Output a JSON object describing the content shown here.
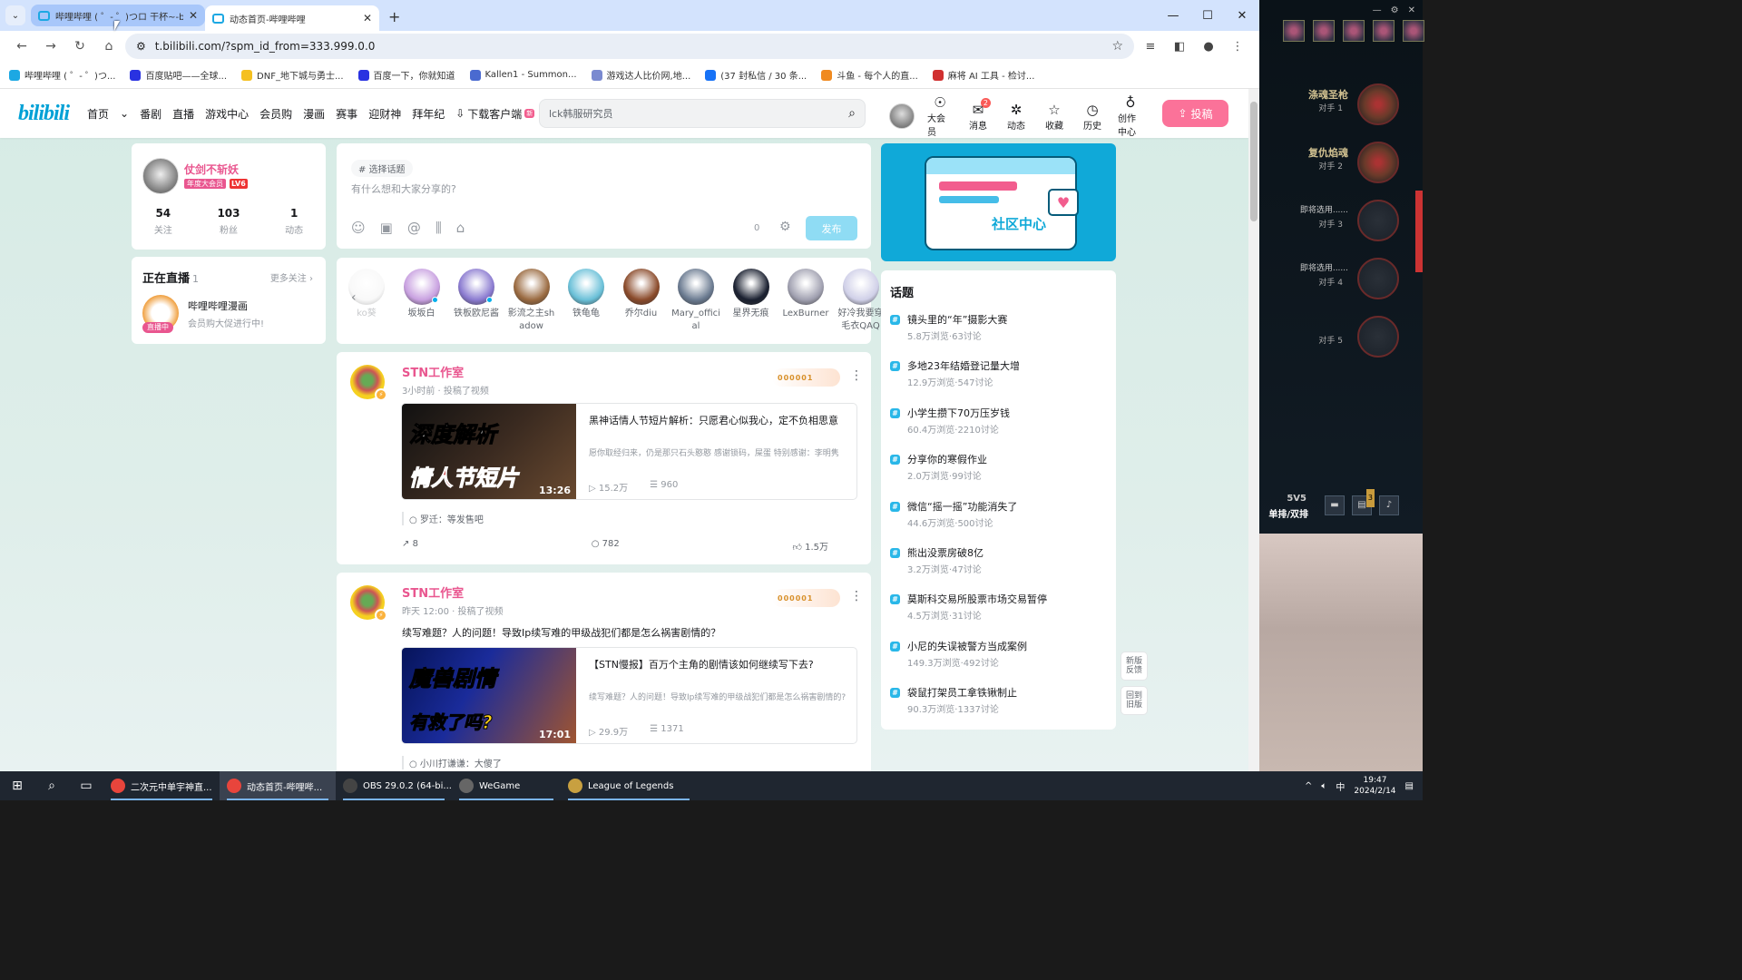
{
  "browser": {
    "tabs": [
      {
        "label": "哔哩哔哩 ( ゜- ゜)つロ 干杯~-bi",
        "active": false
      },
      {
        "label": "动态首页-哔哩哔哩",
        "active": true
      }
    ],
    "url": "t.bilibili.com/?spm_id_from=333.999.0.0",
    "bookmarks": [
      {
        "label": "哔哩哔哩 ( ゜- ゜)つ...",
        "color": "#1ca8e3"
      },
      {
        "label": "百度贴吧——全球...",
        "color": "#2932e1"
      },
      {
        "label": "DNF_地下城与勇士...",
        "color": "#f5c020"
      },
      {
        "label": "百度一下，你就知道",
        "color": "#2932e1"
      },
      {
        "label": "Kallen1 - Summon...",
        "color": "#4a6ad0"
      },
      {
        "label": "游戏达人比价网,地...",
        "color": "#7a8ad0"
      },
      {
        "label": "(37 封私信 / 30 条...",
        "color": "#1772f6"
      },
      {
        "label": "斗鱼 - 每个人的直...",
        "color": "#f08a20"
      },
      {
        "label": "麻将 AI 工具 - 检讨...",
        "color": "#d03030"
      }
    ]
  },
  "header": {
    "logo": "bilibili",
    "nav": [
      "首页",
      "番剧",
      "直播",
      "游戏中心",
      "会员购",
      "漫画",
      "赛事",
      "迎财神",
      "拜年纪"
    ],
    "download": "下载客户端",
    "download_badge": "新",
    "search_placeholder": "lck韩服研究员",
    "icons": [
      {
        "label": "大会员",
        "glyph": "☉"
      },
      {
        "label": "消息",
        "glyph": "✉",
        "badge": "2"
      },
      {
        "label": "动态",
        "glyph": "✲"
      },
      {
        "label": "收藏",
        "glyph": "☆"
      },
      {
        "label": "历史",
        "glyph": "◷"
      },
      {
        "label": "创作中心",
        "glyph": "♁"
      }
    ],
    "upload": "投稿"
  },
  "user": {
    "name": "仗剑不斩妖",
    "vip": "年度大会员",
    "level": "LV6",
    "stats": [
      {
        "value": "54",
        "label": "关注"
      },
      {
        "value": "103",
        "label": "粉丝"
      },
      {
        "value": "1",
        "label": "动态"
      }
    ]
  },
  "live": {
    "title": "正在直播",
    "count": "1",
    "more": "更多关注 ›",
    "tag": "直播中",
    "name": "哔哩哔哩漫画",
    "desc": "会员购大促进行中!"
  },
  "compose": {
    "topic": "选择话题",
    "placeholder": "有什么想和大家分享的?",
    "count": "0",
    "publish": "发布"
  },
  "ups": [
    {
      "name": "ko葵",
      "color": "#eee",
      "live": false
    },
    {
      "name": "坂坂白",
      "color": "#c8a0e0",
      "live": true
    },
    {
      "name": "铁板欧尼酱",
      "color": "#8a7ad0",
      "live": true
    },
    {
      "name": "影流之主shadow",
      "color": "#9a6a40",
      "live": false
    },
    {
      "name": "铁龟龟",
      "color": "#6ac0d8",
      "live": false
    },
    {
      "name": "乔尔diu",
      "color": "#8a4a2a",
      "live": false
    },
    {
      "name": "Mary_official",
      "color": "#6a7a90",
      "live": false
    },
    {
      "name": "星界无痕",
      "color": "#1a2030",
      "live": false
    },
    {
      "name": "LexBurner",
      "color": "#a0a0b0",
      "live": false
    },
    {
      "name": "好冷我要穿毛衣QAQ",
      "color": "#d0d0e8",
      "live": false
    }
  ],
  "posts": [
    {
      "author": "STN工作室",
      "meta": "3小时前 · 投稿了视频",
      "fan": "000001",
      "text": "",
      "video": {
        "thumb_line1": "深度解析",
        "thumb_line2": "情人节短片",
        "duration": "13:26",
        "title": "黑神话情人节短片解析：只愿君心似我心，定不负相思意",
        "desc": "愿你取经归来，仍是那只石头憨憨 感谢锁码，屎蛋 特别感谢：李明隽",
        "views": "15.2万",
        "danmaku": "960"
      },
      "reply": "罗迁：等发售吧",
      "share": "8",
      "comments": "782",
      "likes": "1.5万"
    },
    {
      "author": "STN工作室",
      "meta": "昨天 12:00 · 投稿了视频",
      "fan": "000001",
      "text": "续写难题？人的问题！导致Ip续写难的甲级战犯们都是怎么祸害剧情的？",
      "video": {
        "thumb_line1": "魔兽剧情",
        "thumb_line2": "有救了吗?",
        "duration": "17:01",
        "title": "【STN慢报】百万个主角的剧情该如何继续写下去?",
        "desc": "续写难题？人的问题！导致Ip续写难的甲级战犯们都是怎么祸害剧情的?",
        "views": "29.9万",
        "danmaku": "1371"
      },
      "reply": "小川打谦谦：大傻了"
    }
  ],
  "banner": {
    "text": "社区中心"
  },
  "topics": {
    "title": "话题",
    "items": [
      {
        "title": "镜头里的“年”摄影大赛",
        "stats": "5.8万浏览·63讨论"
      },
      {
        "title": "多地23年结婚登记量大增",
        "stats": "12.9万浏览·547讨论"
      },
      {
        "title": "小学生攒下70万压岁钱",
        "stats": "60.4万浏览·2210讨论"
      },
      {
        "title": "分享你的寒假作业",
        "stats": "2.0万浏览·99讨论"
      },
      {
        "title": "微信“摇一摇”功能消失了",
        "stats": "44.6万浏览·500讨论"
      },
      {
        "title": "熊出没票房破8亿",
        "stats": "3.2万浏览·47讨论"
      },
      {
        "title": "莫斯科交易所股票市场交易暂停",
        "stats": "4.5万浏览·31讨论"
      },
      {
        "title": "小尼的失误被警方当成案例",
        "stats": "149.3万浏览·492讨论"
      },
      {
        "title": "袋鼠打架员工拿铁锹制止",
        "stats": "90.3万浏览·1337讨论"
      }
    ]
  },
  "side_buttons": [
    "新版反馈",
    "回到旧版"
  ],
  "game": {
    "players": [
      {
        "name": "涤魂圣枪",
        "sub": "对手 1",
        "filled": true
      },
      {
        "name": "复仇焰魂",
        "sub": "对手 2",
        "filled": true
      },
      {
        "name": "即将选用......",
        "sub": "对手 3",
        "filled": false
      },
      {
        "name": "即将选用......",
        "sub": "对手 4",
        "filled": false
      },
      {
        "name": "",
        "sub": "对手 5",
        "filled": false
      }
    ],
    "mode_a": "5V5",
    "mode_b": "单排/双排",
    "badge": "3"
  },
  "taskbar": {
    "apps": [
      {
        "label": "二次元中单宇神直...",
        "color": "#e8453c",
        "active": false
      },
      {
        "label": "动态首页-哔哩哔...",
        "color": "#e8453c",
        "active": true
      },
      {
        "label": "OBS 29.0.2 (64-bi...",
        "color": "#444",
        "active": false
      },
      {
        "label": "WeGame",
        "color": "#666",
        "active": false
      },
      {
        "label": "League of Legends",
        "color": "#c8a040",
        "active": false
      }
    ],
    "ime": "中",
    "time": "19:47",
    "date": "2024/2/14"
  }
}
